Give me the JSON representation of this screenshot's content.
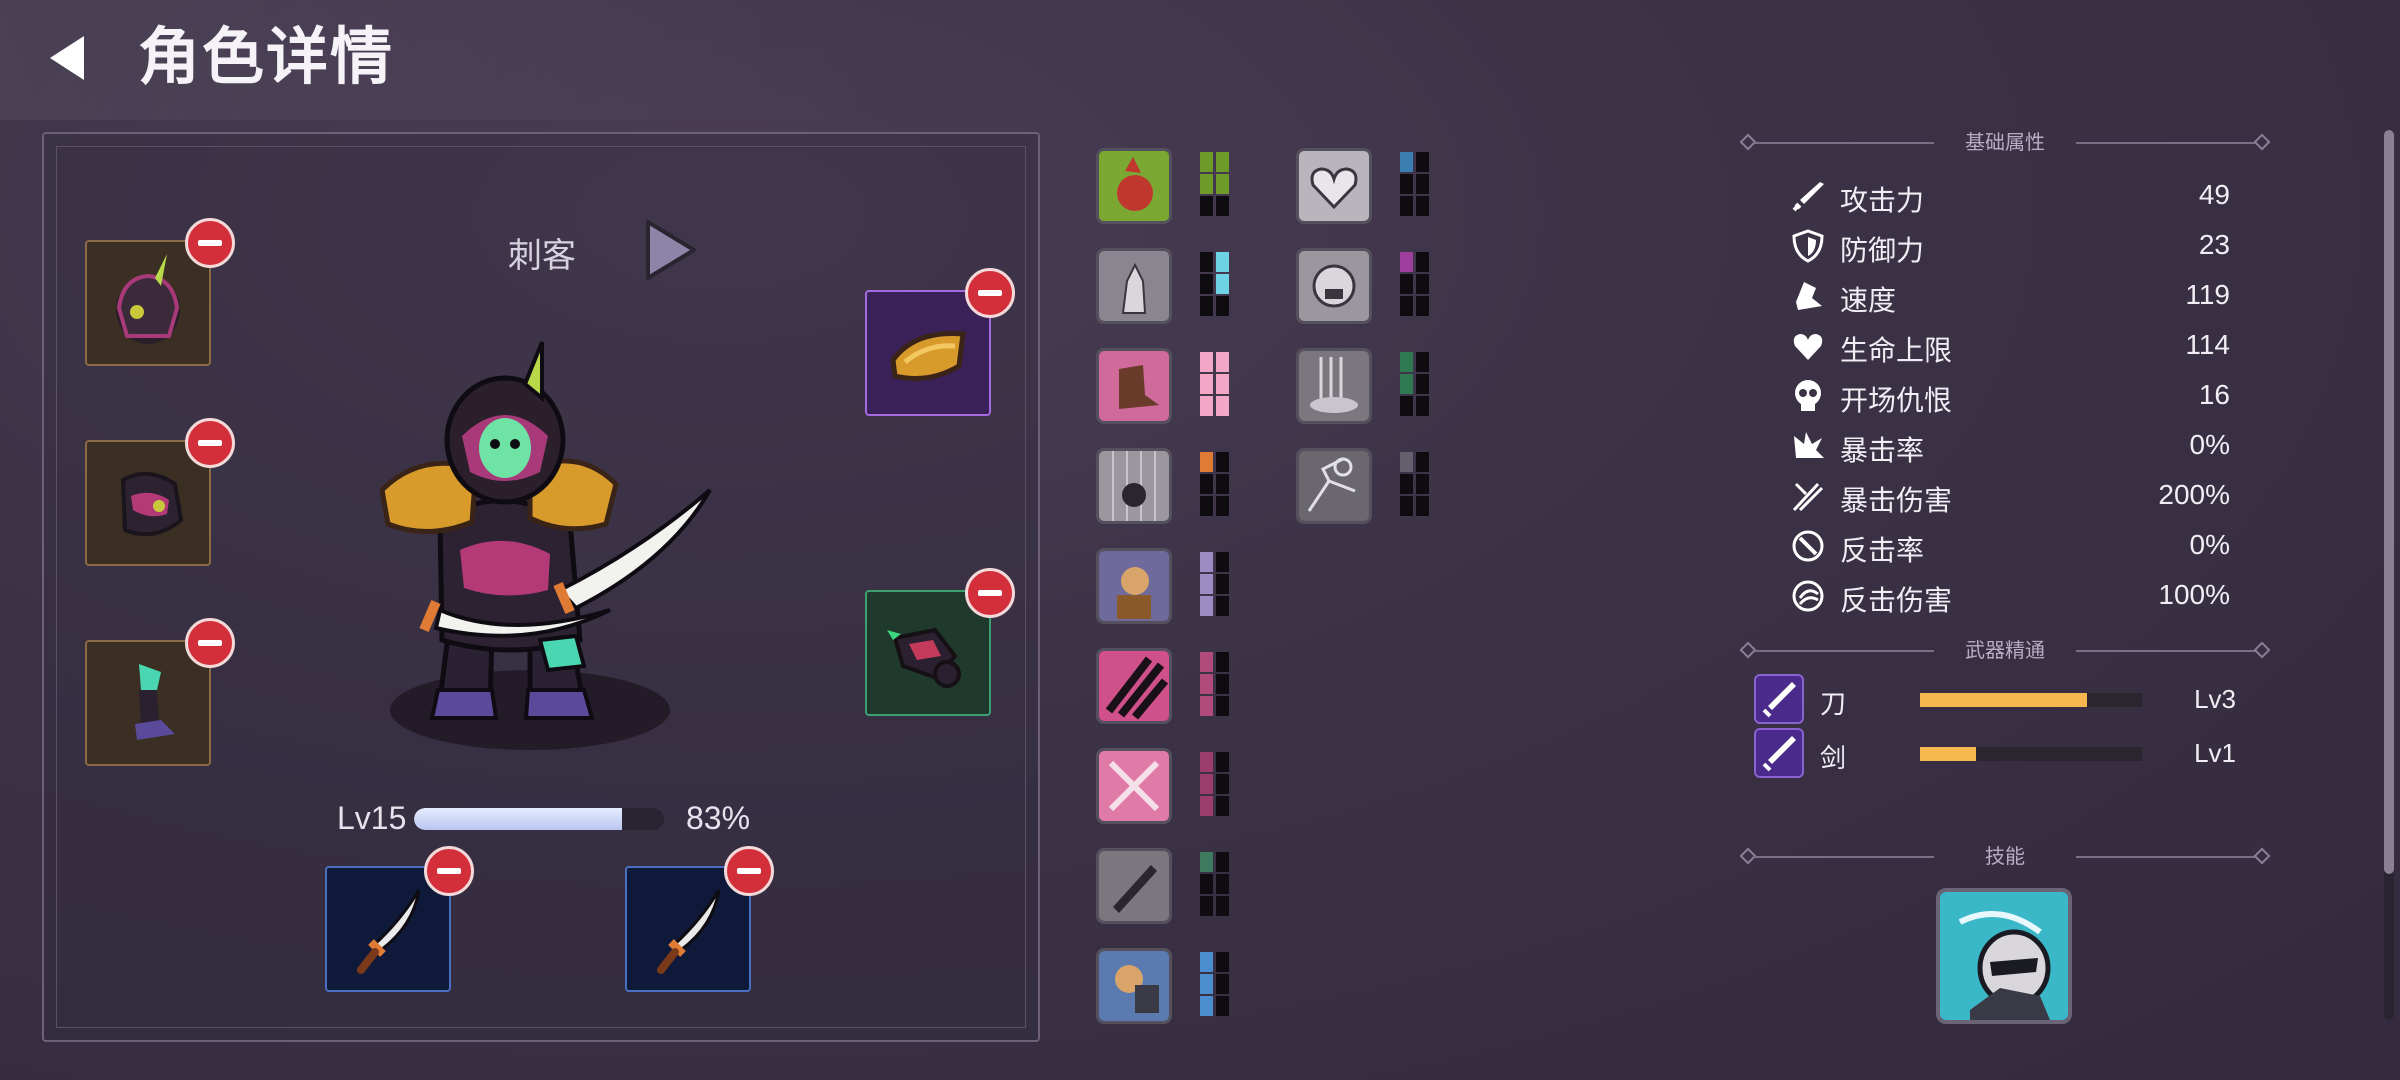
{
  "header": {
    "title": "角色详情",
    "back_icon": "back-arrow-icon"
  },
  "character": {
    "class_name": "刺客",
    "level_label": "Lv15",
    "xp_percent_label": "83%",
    "xp_fraction": 0.83
  },
  "equipment": {
    "left_slots": [
      {
        "icon": "helmet-icon",
        "removable": true
      },
      {
        "icon": "chest-armor-icon",
        "removable": true
      },
      {
        "icon": "boots-icon",
        "removable": true
      }
    ],
    "right_slots": [
      {
        "icon": "shoulder-armor-icon",
        "removable": true
      },
      {
        "icon": "gauntlet-icon",
        "removable": true
      }
    ],
    "weapon_slots": [
      {
        "icon": "dagger-icon",
        "removable": true
      },
      {
        "icon": "dagger-icon",
        "removable": true
      }
    ]
  },
  "relics": {
    "col1": [
      {
        "icon": "rage-fist-icon",
        "pip_color": "#6e9a2a"
      },
      {
        "icon": "statue-icon",
        "pip_color": "#6fd3e6"
      },
      {
        "icon": "boot-stomp-icon",
        "pip_color": "#f2a7c6"
      },
      {
        "icon": "rain-knight-icon",
        "pip_color": "#e07b36"
      },
      {
        "icon": "warrior-portrait-icon",
        "pip_color": "#9b8dc4"
      },
      {
        "icon": "claw-slash-icon",
        "pip_color": "#b14c7a"
      },
      {
        "icon": "crossed-blades-icon",
        "pip_color": "#9c3d6e"
      },
      {
        "icon": "dark-blade-icon",
        "pip_color": "#3d7a60"
      },
      {
        "icon": "brute-fist-icon",
        "pip_color": "#4a8ed0"
      }
    ],
    "col2": [
      {
        "icon": "heart-plus-icon",
        "pip_color": "#3a7fb0"
      },
      {
        "icon": "roaring-face-icon",
        "pip_color": "#9e3d9c"
      },
      {
        "icon": "waterfall-icon",
        "pip_color": "#2f7a52"
      },
      {
        "icon": "shattered-icon",
        "pip_color": "#66606e"
      }
    ]
  },
  "stats": {
    "section_title": "基础属性",
    "rows": [
      {
        "icon": "sword-icon",
        "name": "攻击力",
        "value": "49"
      },
      {
        "icon": "shield-icon",
        "name": "防御力",
        "value": "23"
      },
      {
        "icon": "boot-speed-icon",
        "name": "速度",
        "value": "119"
      },
      {
        "icon": "heart-icon",
        "name": "生命上限",
        "value": "114"
      },
      {
        "icon": "skull-icon",
        "name": "开场仇恨",
        "value": "16"
      },
      {
        "icon": "crit-burst-icon",
        "name": "暴击率",
        "value": "0%"
      },
      {
        "icon": "crit-damage-icon",
        "name": "暴击伤害",
        "value": "200%"
      },
      {
        "icon": "counter-icon",
        "name": "反击率",
        "value": "0%"
      },
      {
        "icon": "counter-damage-icon",
        "name": "反击伤害",
        "value": "100%"
      }
    ]
  },
  "weapon_mastery": {
    "section_title": "武器精通",
    "rows": [
      {
        "icon": "blade-mastery-icon",
        "name": "刀",
        "level": "Lv3",
        "progress": 0.75
      },
      {
        "icon": "sword-mastery-icon",
        "name": "剑",
        "level": "Lv1",
        "progress": 0.25
      }
    ]
  },
  "skills": {
    "section_title": "技能",
    "items": [
      {
        "icon": "assassin-skill-icon"
      }
    ]
  },
  "colors": {
    "accent_bar": "#f6b84f",
    "remove_badge": "#d32f3a",
    "xp_fill": "#c8d3f5"
  }
}
